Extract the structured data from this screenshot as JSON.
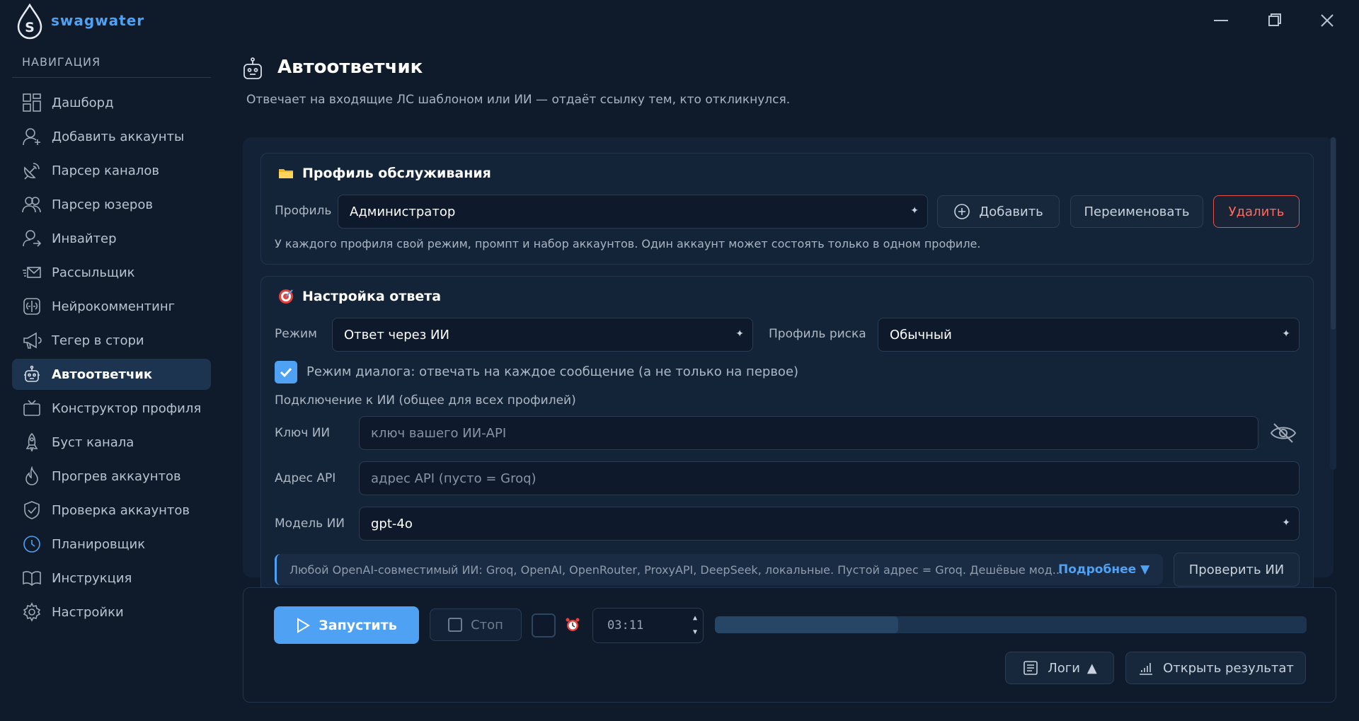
{
  "app": {
    "title": "swagwater"
  },
  "nav": {
    "heading": "НАВИГАЦИЯ",
    "items": [
      {
        "label": "Дашборд",
        "icon": "dashboard-icon"
      },
      {
        "label": "Добавить аккаунты",
        "icon": "add-user-icon"
      },
      {
        "label": "Парсер каналов",
        "icon": "satellite-icon"
      },
      {
        "label": "Парсер юзеров",
        "icon": "users-icon"
      },
      {
        "label": "Инвайтер",
        "icon": "invite-user-icon"
      },
      {
        "label": "Рассыльщик",
        "icon": "send-mail-icon"
      },
      {
        "label": "Нейрокомментинг",
        "icon": "brain-icon"
      },
      {
        "label": "Тегер в стори",
        "icon": "megaphone-icon"
      },
      {
        "label": "Автоответчик",
        "icon": "robot-icon",
        "active": true
      },
      {
        "label": "Конструктор профиля",
        "icon": "tv-icon"
      },
      {
        "label": "Буст канала",
        "icon": "rocket-icon"
      },
      {
        "label": "Прогрев аккаунтов",
        "icon": "flame-icon"
      },
      {
        "label": "Проверка аккаунтов",
        "icon": "shield-check-icon"
      },
      {
        "label": "Планировщик",
        "icon": "clock-icon"
      },
      {
        "label": "Инструкция",
        "icon": "book-icon"
      },
      {
        "label": "Настройки",
        "icon": "gear-icon"
      }
    ]
  },
  "header": {
    "title": "Автоответчик",
    "subtitle": "Отвечает на входящие ЛС шаблоном или ИИ — отдаёт ссылку тем, кто откликнулся."
  },
  "profile_card": {
    "title": "Профиль обслуживания",
    "profile_label": "Профиль",
    "profile_value": "Администратор",
    "add_label": "Добавить",
    "rename_label": "Переименовать",
    "delete_label": "Удалить",
    "hint": "У каждого профиля свой режим, промпт и набор аккаунтов. Один аккаунт может состоять только в одном профиле."
  },
  "response_card": {
    "title": "Настройка ответа",
    "mode_label": "Режим",
    "mode_value": "Ответ через ИИ",
    "risk_label": "Профиль риска",
    "risk_value": "Обычный",
    "dialog_mode_label": "Режим диалога: отвечать на каждое сообщение (а не только на первое)",
    "dialog_mode_checked": true,
    "ai_section_label": "Подключение к ИИ (общее для всех профилей)",
    "key_label": "Ключ ИИ",
    "key_placeholder": "ключ вашего ИИ-API",
    "api_label": "Адрес API",
    "api_placeholder": "адрес API (пусто = Groq)",
    "model_label": "Модель ИИ",
    "model_value": "gpt-4o",
    "info_text": "Любой OpenAI-совместимый ИИ: Groq, OpenAI, OpenRouter, ProxyAPI, DeepSeek, локальные. Пустой адрес = Groq. Дешёвые мод...",
    "more_label": "Подробнее",
    "check_ai_label": "Проверить ИИ"
  },
  "controls": {
    "start_label": "Запустить",
    "stop_label": "Стоп",
    "time_value": "03:11",
    "progress": 0.31,
    "logs_label": "Логи",
    "open_result_label": "Открыть результат"
  },
  "colors": {
    "accent": "#4ea1f3",
    "danger": "#e0524a",
    "background": "#0f1b2b"
  }
}
